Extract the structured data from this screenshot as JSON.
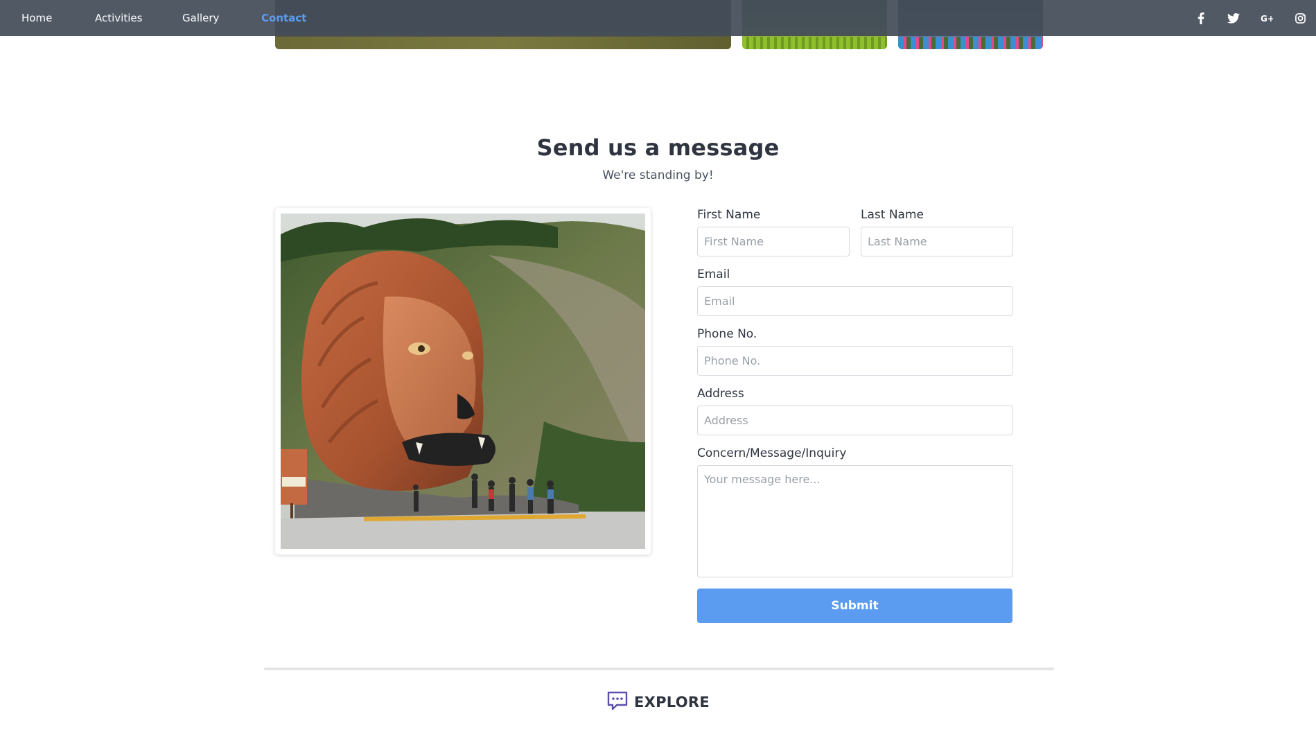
{
  "nav": {
    "links": [
      {
        "label": "Home"
      },
      {
        "label": "Activities"
      },
      {
        "label": "Gallery"
      },
      {
        "label": "Contact",
        "active": true
      }
    ],
    "social_icons": [
      "facebook-icon",
      "twitter-icon",
      "google-plus-icon",
      "instagram-icon"
    ]
  },
  "contact": {
    "title": "Send us a message",
    "subtitle": "We're standing by!"
  },
  "form": {
    "first_name": {
      "label": "First Name",
      "placeholder": "First Name",
      "value": ""
    },
    "last_name": {
      "label": "Last Name",
      "placeholder": "Last Name",
      "value": ""
    },
    "email": {
      "label": "Email",
      "placeholder": "Email",
      "value": ""
    },
    "phone": {
      "label": "Phone No.",
      "placeholder": "Phone No.",
      "value": ""
    },
    "address": {
      "label": "Address",
      "placeholder": "Address",
      "value": ""
    },
    "message": {
      "label": "Concern/Message/Inquiry",
      "placeholder": "Your message here...",
      "value": ""
    },
    "submit_label": "Submit"
  },
  "footer": {
    "explore_label": "EXPLORE"
  },
  "colors": {
    "accent": "#5b9cf0",
    "navbar": "#444c58",
    "text": "#2f3540",
    "explore_icon": "#5a4fb0"
  }
}
